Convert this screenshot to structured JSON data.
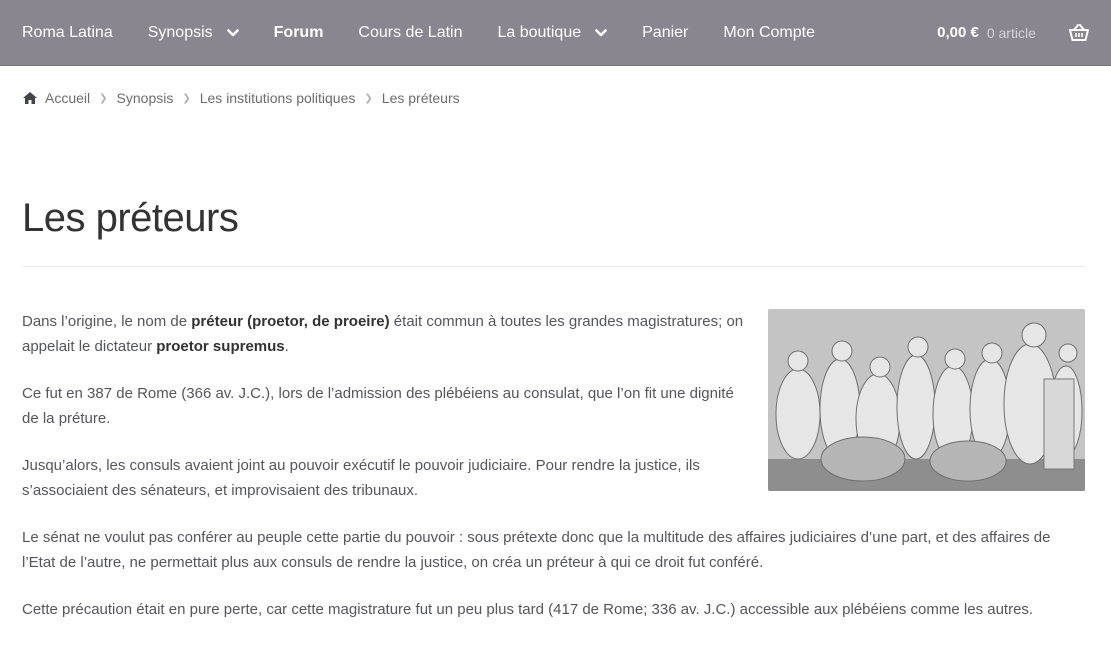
{
  "nav": {
    "items": [
      {
        "label": "Roma Latina",
        "bold": false,
        "dropdown": false
      },
      {
        "label": "Synopsis",
        "bold": false,
        "dropdown": true
      },
      {
        "label": "Forum",
        "bold": true,
        "dropdown": false
      },
      {
        "label": "Cours de Latin",
        "bold": false,
        "dropdown": false
      },
      {
        "label": "La boutique",
        "bold": false,
        "dropdown": true
      },
      {
        "label": "Panier",
        "bold": false,
        "dropdown": false
      },
      {
        "label": "Mon Compte",
        "bold": false,
        "dropdown": false
      }
    ]
  },
  "cart": {
    "amount": "0,00 €",
    "count": "0 article"
  },
  "breadcrumb": {
    "items": [
      "Accueil",
      "Synopsis",
      "Les institutions politiques",
      "Les préteurs"
    ]
  },
  "page": {
    "title": "Les préteurs",
    "p1_a": "Dans l’origine, le nom de ",
    "p1_b": "préteur (proetor, de proeire)",
    "p1_c": " était commun à toutes les grandes magistratures; on appelait le dictateur ",
    "p1_d": "proetor supremus",
    "p1_e": ".",
    "p2": "Ce fut en 387 de Rome (366 av. J.C.), lors de l’admission des plébéiens au consulat, que l’on fit une dignité de la préture.",
    "p3": "Jusqu’alors, les consuls avaient joint au pouvoir exécutif le pouvoir judiciaire. Pour rendre la justice, ils s’associaient des sénateurs, et improvisaient des tribunaux.",
    "p4": "Le sénat ne voulut pas conférer au peuple cette partie du pouvoir : sous prétexte donc que la multitude des affaires judiciaires d’une part, et des affaires de l’Etat de l’autre, ne permettait plus aux consuls de rendre la justice, on créa un préteur à qui ce droit fut conféré.",
    "p5": "Cette précaution était en pure perte, car cette magistrature fut un peu plus tard (417 de Rome; 336 av. J.C.) accessible aux plébéiens comme les autres."
  },
  "colors": {
    "header_bg": "#8a8690",
    "text": "#55565c",
    "title": "#333333"
  }
}
